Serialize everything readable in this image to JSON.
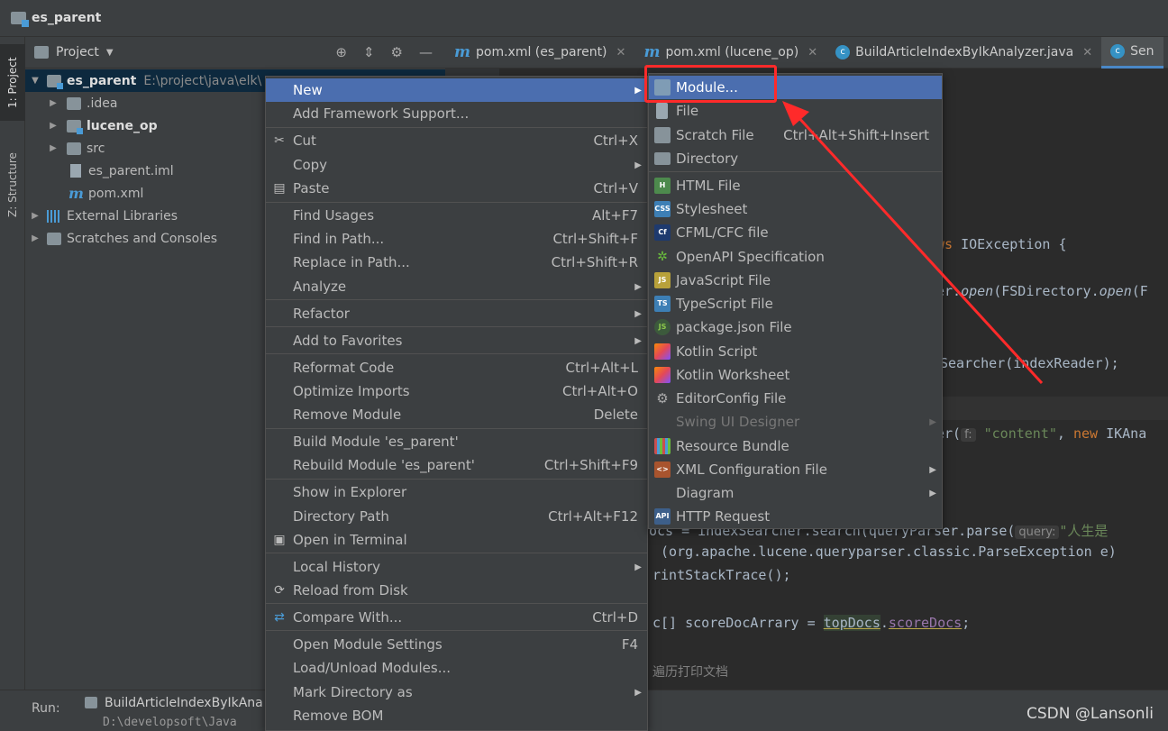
{
  "window": {
    "title": "es_parent"
  },
  "left_tabs": {
    "project": "1: Project",
    "structure": "Z: Structure"
  },
  "project_panel": {
    "header_label": "Project",
    "tree": [
      {
        "label": "es_parent",
        "path": "E:\\project\\java\\elk\\"
      },
      {
        "label": ".idea"
      },
      {
        "label": "lucene_op"
      },
      {
        "label": "src"
      },
      {
        "label": "es_parent.iml"
      },
      {
        "label": "pom.xml"
      },
      {
        "label": "External Libraries"
      },
      {
        "label": "Scratches and Consoles"
      }
    ]
  },
  "editor_tabs": [
    {
      "label": "pom.xml (es_parent)"
    },
    {
      "label": "pom.xml (lucene_op)"
    },
    {
      "label": "BuildArticleIndexByIkAnalyzer.java"
    },
    {
      "label": "Sen"
    }
  ],
  "editor": {
    "lines": [
      {
        "t1": "ws",
        "t2": " IOException {"
      },
      {
        "t1": "er.",
        "t2": "open",
        "t3": "(FSDirectory.",
        "t4": "open",
        "t5": "(F"
      },
      {
        "t1": "Searcher(indexReader);"
      },
      {
        "t1": "er(",
        "hint": "f:",
        "str": "\"content\"",
        "t2": ", ",
        "kw": "new",
        "t3": " IKAna"
      },
      {
        "t1": "ocs = indexSearcher.search(queryParser.parse(",
        "hint": "query:",
        "str": "\"人生是"
      },
      {
        "t1": " (org.apache.lucene.queryparser.classic.ParseException e) "
      },
      {
        "t1": "rintStackTrace();"
      },
      {
        "t1": "c[] scoreDocArrary = ",
        "u": "topDocs",
        "t2": ".",
        "fld": "scoreDocs",
        "t3": ";"
      },
      {
        "cmt": "遍历打印文档"
      }
    ]
  },
  "context_menu": {
    "items": [
      {
        "label": "New",
        "shortcut": ""
      },
      {
        "label": "Add Framework Support...",
        "shortcut": ""
      },
      {
        "label": "Cut",
        "shortcut": "Ctrl+X"
      },
      {
        "label": "Copy",
        "shortcut": ""
      },
      {
        "label": "Paste",
        "shortcut": "Ctrl+V"
      },
      {
        "label": "Find Usages",
        "shortcut": "Alt+F7"
      },
      {
        "label": "Find in Path...",
        "shortcut": "Ctrl+Shift+F"
      },
      {
        "label": "Replace in Path...",
        "shortcut": "Ctrl+Shift+R"
      },
      {
        "label": "Analyze",
        "shortcut": ""
      },
      {
        "label": "Refactor",
        "shortcut": ""
      },
      {
        "label": "Add to Favorites",
        "shortcut": ""
      },
      {
        "label": "Reformat Code",
        "shortcut": "Ctrl+Alt+L"
      },
      {
        "label": "Optimize Imports",
        "shortcut": "Ctrl+Alt+O"
      },
      {
        "label": "Remove Module",
        "shortcut": "Delete"
      },
      {
        "label": "Build Module 'es_parent'",
        "shortcut": ""
      },
      {
        "label": "Rebuild Module 'es_parent'",
        "shortcut": "Ctrl+Shift+F9"
      },
      {
        "label": "Show in Explorer",
        "shortcut": ""
      },
      {
        "label": "Directory Path",
        "shortcut": "Ctrl+Alt+F12"
      },
      {
        "label": "Open in Terminal",
        "shortcut": ""
      },
      {
        "label": "Local History",
        "shortcut": ""
      },
      {
        "label": "Reload from Disk",
        "shortcut": ""
      },
      {
        "label": "Compare With...",
        "shortcut": "Ctrl+D"
      },
      {
        "label": "Open Module Settings",
        "shortcut": "F4"
      },
      {
        "label": "Load/Unload Modules...",
        "shortcut": ""
      },
      {
        "label": "Mark Directory as",
        "shortcut": ""
      },
      {
        "label": "Remove BOM",
        "shortcut": ""
      }
    ]
  },
  "new_submenu": {
    "items": [
      {
        "label": "Module...",
        "shortcut": "",
        "icon": "module-icon"
      },
      {
        "label": "File",
        "shortcut": "",
        "icon": "file-icon"
      },
      {
        "label": "Scratch File",
        "shortcut": "Ctrl+Alt+Shift+Insert",
        "icon": "scratch-file-icon"
      },
      {
        "label": "Directory",
        "shortcut": "",
        "icon": "folder-icon"
      },
      {
        "label": "HTML File",
        "shortcut": "",
        "icon": "html-icon"
      },
      {
        "label": "Stylesheet",
        "shortcut": "",
        "icon": "css-icon"
      },
      {
        "label": "CFML/CFC file",
        "shortcut": "",
        "icon": "cf-icon"
      },
      {
        "label": "OpenAPI Specification",
        "shortcut": "",
        "icon": "openapi-icon"
      },
      {
        "label": "JavaScript File",
        "shortcut": "",
        "icon": "js-icon"
      },
      {
        "label": "TypeScript File",
        "shortcut": "",
        "icon": "ts-icon"
      },
      {
        "label": "package.json File",
        "shortcut": "",
        "icon": "nodejs-icon"
      },
      {
        "label": "Kotlin Script",
        "shortcut": "",
        "icon": "kotlin-icon"
      },
      {
        "label": "Kotlin Worksheet",
        "shortcut": "",
        "icon": "kotlin-icon"
      },
      {
        "label": "EditorConfig File",
        "shortcut": "",
        "icon": "gear-icon"
      },
      {
        "label": "Swing UI Designer",
        "shortcut": "",
        "icon": ""
      },
      {
        "label": "Resource Bundle",
        "shortcut": "",
        "icon": "resource-bundle-icon"
      },
      {
        "label": "XML Configuration File",
        "shortcut": "",
        "icon": "xml-icon"
      },
      {
        "label": "Diagram",
        "shortcut": "",
        "icon": ""
      },
      {
        "label": "HTTP Request",
        "shortcut": "",
        "icon": "api-icon"
      }
    ]
  },
  "run_bar": {
    "label": "Run:",
    "tab": "BuildArticleIndexByIkAna",
    "output": "D:\\developsoft\\Java"
  },
  "watermark": "CSDN @Lansonli",
  "colors": {
    "accent": "#4b6eaf",
    "annotation": "#ff2a2a",
    "background": "#2b2b2b",
    "panel": "#3c3f41"
  }
}
